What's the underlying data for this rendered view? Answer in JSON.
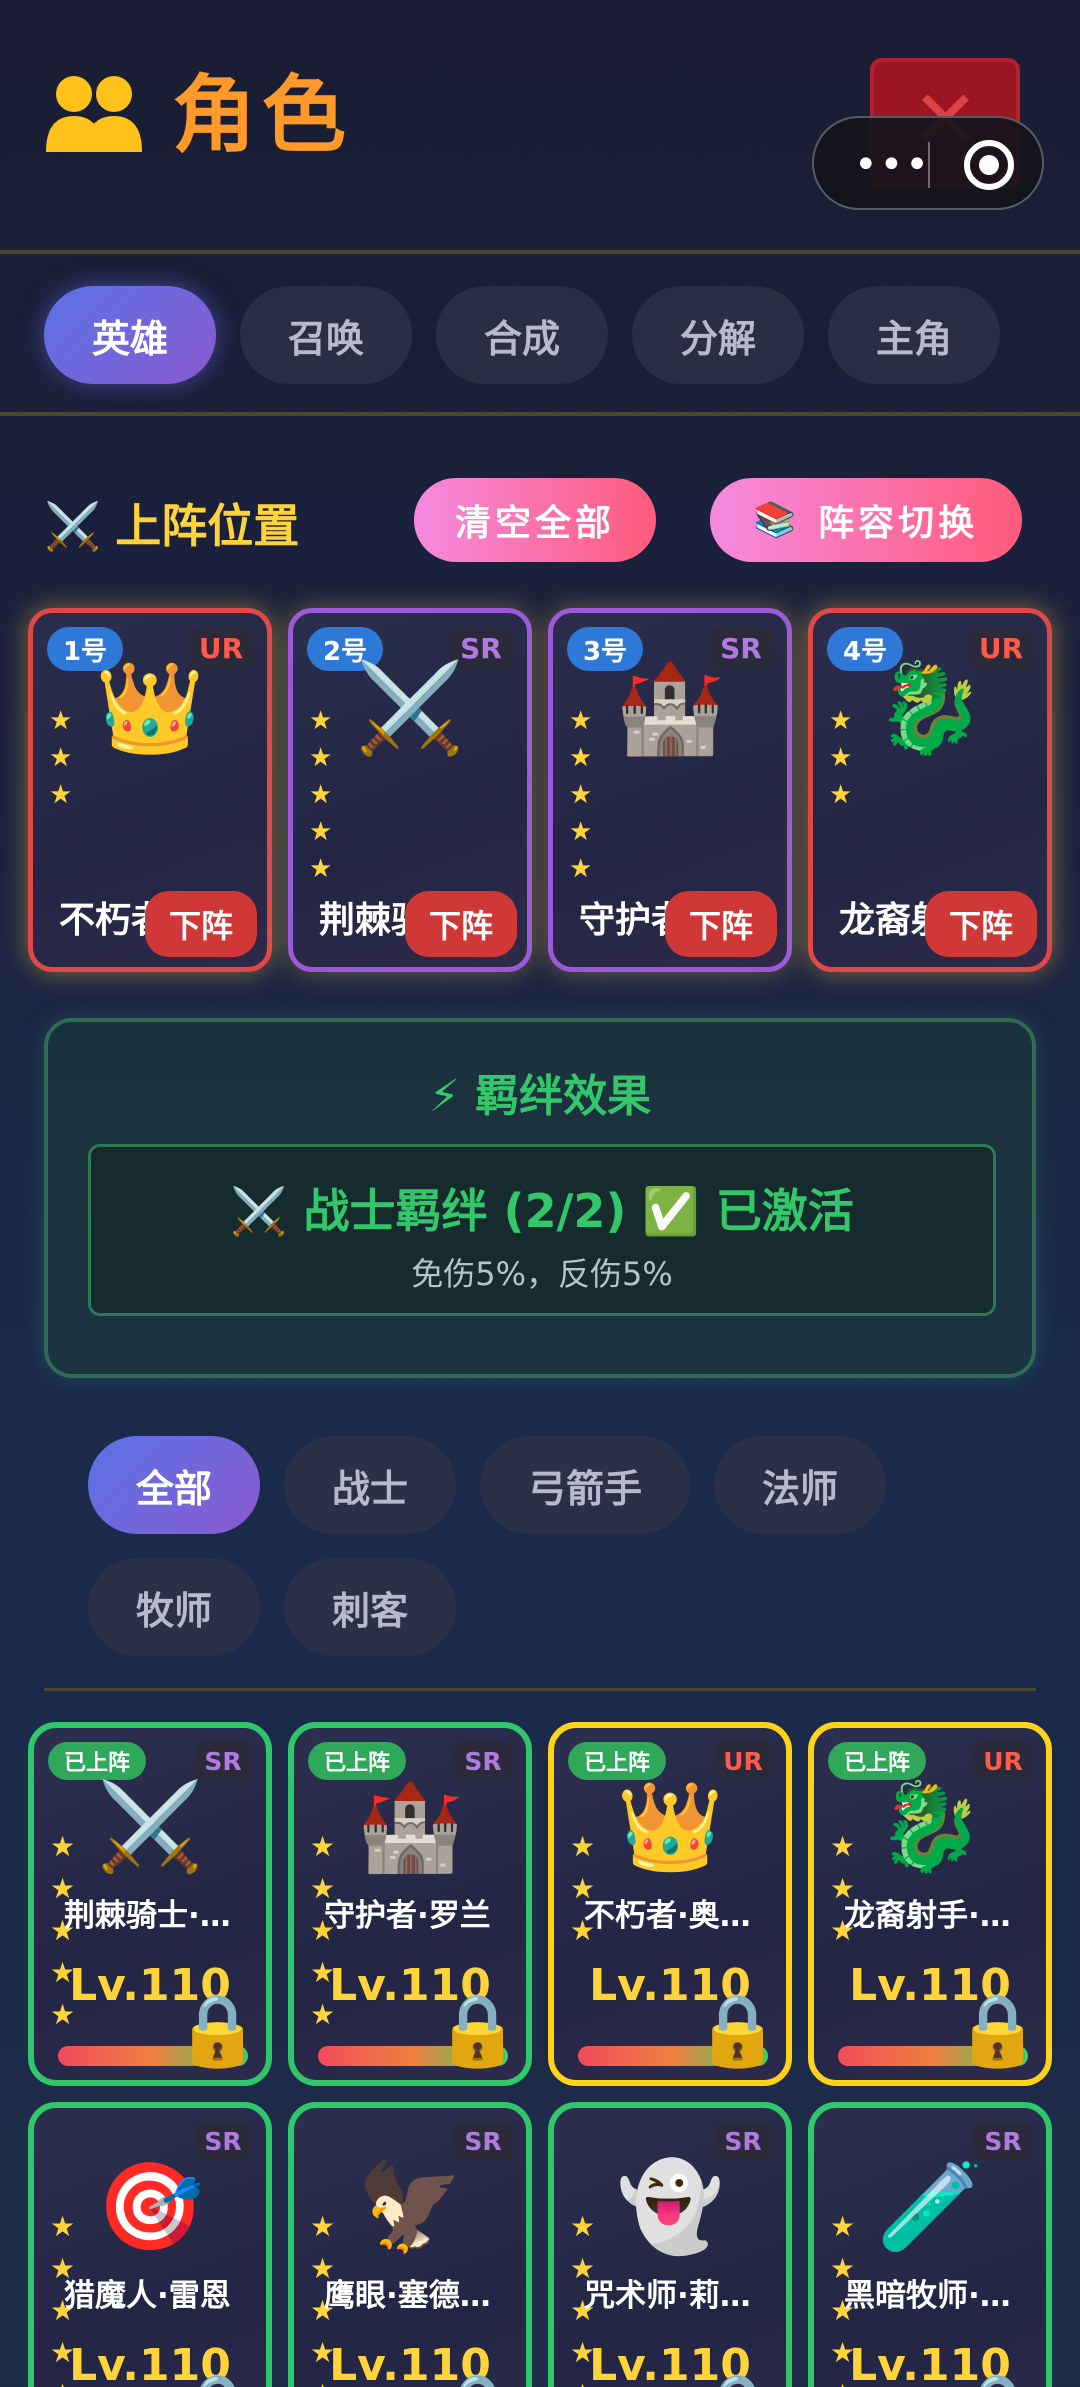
{
  "header": {
    "title": "角色",
    "title_icon": "people-icon",
    "close_icon": "✕"
  },
  "capsule": {
    "dots": "•••",
    "target_icon": "target-icon"
  },
  "tabs": [
    {
      "label": "英雄",
      "active": true
    },
    {
      "label": "召唤",
      "active": false
    },
    {
      "label": "合成",
      "active": false
    },
    {
      "label": "分解",
      "active": false
    },
    {
      "label": "主角",
      "active": false
    }
  ],
  "lineup": {
    "title": "上阵位置",
    "title_icon": "⚔️",
    "clear_label": "清空全部",
    "switch_icon": "📚",
    "switch_label": "阵容切换",
    "slots": [
      {
        "num": "1号",
        "rarity": "UR",
        "emoji": "👑",
        "stars": [
          "★",
          "★",
          "★"
        ],
        "name": "不朽者",
        "down": "下阵"
      },
      {
        "num": "2号",
        "rarity": "SR",
        "emoji": "⚔️",
        "stars": [
          "★",
          "★",
          "★",
          "★",
          "★"
        ],
        "name": "荆棘骑士",
        "down": "下阵"
      },
      {
        "num": "3号",
        "rarity": "SR",
        "emoji": "🏰",
        "stars": [
          "★",
          "★",
          "★",
          "★",
          "★"
        ],
        "name": "守护者",
        "down": "下阵"
      },
      {
        "num": "4号",
        "rarity": "UR",
        "emoji": "🐉",
        "stars": [
          "★",
          "★",
          "★"
        ],
        "name": "龙裔射手",
        "down": "下阵"
      }
    ]
  },
  "bond": {
    "title": "⚡ 羁绊效果",
    "line1": "⚔️ 战士羁绊 (2/2) ✅ 已激活",
    "line2": "免伤5%，反伤5%"
  },
  "filters": [
    {
      "label": "全部",
      "active": true
    },
    {
      "label": "战士",
      "active": false
    },
    {
      "label": "弓箭手",
      "active": false
    },
    {
      "label": "法师",
      "active": false
    },
    {
      "label": "牧师",
      "active": false
    },
    {
      "label": "刺客",
      "active": false
    }
  ],
  "heroes": [
    {
      "tag": "已上阵",
      "rarity": "SR",
      "emoji": "⚔️",
      "name": "荆棘骑士·…",
      "level": "Lv.110",
      "stars": [
        "★",
        "★",
        "★",
        "★",
        "★"
      ],
      "lock": "🔒"
    },
    {
      "tag": "已上阵",
      "rarity": "SR",
      "emoji": "🏰",
      "name": "守护者·罗兰",
      "level": "Lv.110",
      "stars": [
        "★",
        "★",
        "★",
        "★",
        "★"
      ],
      "lock": "🔒"
    },
    {
      "tag": "已上阵",
      "rarity": "UR",
      "emoji": "👑",
      "name": "不朽者·奥…",
      "level": "Lv.110",
      "stars": [
        "★",
        "★",
        "★"
      ],
      "lock": "🔒"
    },
    {
      "tag": "已上阵",
      "rarity": "UR",
      "emoji": "🐉",
      "name": "龙裔射手·…",
      "level": "Lv.110",
      "stars": [
        "★",
        "★",
        "★"
      ],
      "lock": "🔒"
    },
    {
      "tag": "",
      "rarity": "SR",
      "emoji": "🎯",
      "name": "猎魔人·雷恩",
      "level": "Lv.110",
      "stars": [
        "★",
        "★",
        "★",
        "★",
        "★"
      ],
      "lock": "🔒"
    },
    {
      "tag": "",
      "rarity": "SR",
      "emoji": "🦅",
      "name": "鹰眼·塞德…",
      "level": "Lv.110",
      "stars": [
        "★",
        "★",
        "★",
        "★",
        "★"
      ],
      "lock": "🔒"
    },
    {
      "tag": "",
      "rarity": "SR",
      "emoji": "👻",
      "name": "咒术师·莉…",
      "level": "Lv.110",
      "stars": [
        "★",
        "★",
        "★",
        "★",
        "★"
      ],
      "lock": "🔒"
    },
    {
      "tag": "",
      "rarity": "SR",
      "emoji": "🧪",
      "name": "黑暗牧师·…",
      "level": "Lv.110",
      "stars": [
        "★",
        "★",
        "★",
        "★",
        "★"
      ],
      "lock": "🔒"
    }
  ],
  "colors": {
    "accent": "#ff9a2a",
    "gold": "#ffd43a",
    "green": "#34c76a",
    "ur": "#e04848",
    "sr": "#9a5ad8"
  }
}
